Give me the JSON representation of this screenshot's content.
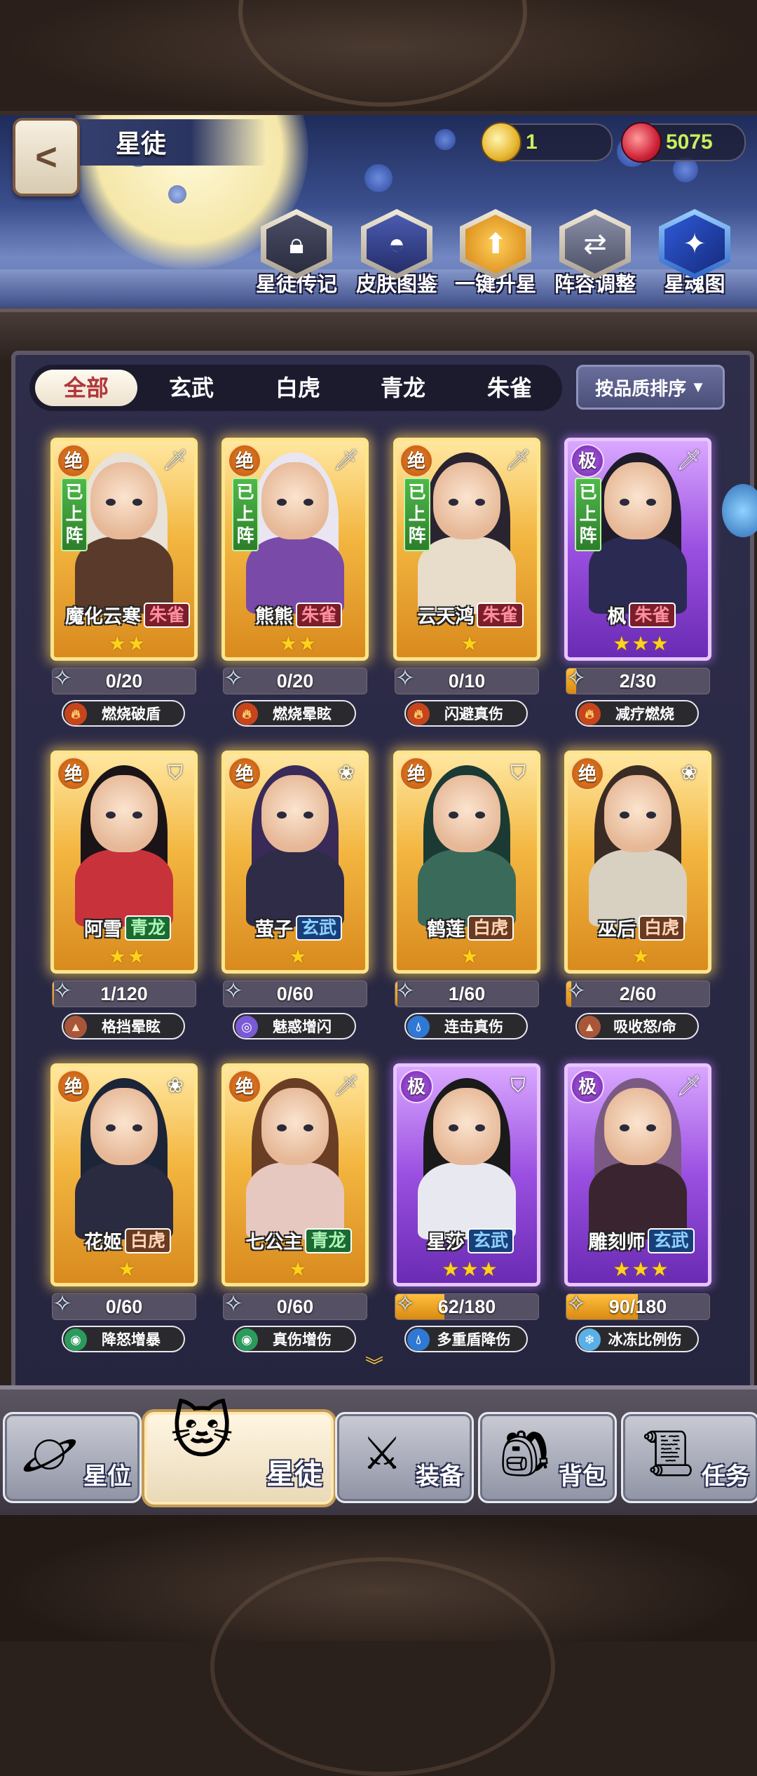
{
  "header": {
    "title": "星徒",
    "coins": "1",
    "gems": "5075"
  },
  "utility_buttons": [
    {
      "label": "星徒传记",
      "icon": "lock-icon"
    },
    {
      "label": "皮肤图鉴",
      "icon": "hood-icon"
    },
    {
      "label": "一键升星",
      "icon": "arrow-up-icon"
    },
    {
      "label": "阵容调整",
      "icon": "team-swap-icon"
    },
    {
      "label": "星魂图",
      "icon": "constellation-icon"
    }
  ],
  "tabs": [
    "全部",
    "玄武",
    "白虎",
    "青龙",
    "朱雀"
  ],
  "active_tab": "全部",
  "sort_label": "按品质排序",
  "cards": [
    {
      "rank": "绝",
      "quality": "gold",
      "role": "sword",
      "deployed": true,
      "name": "魔化云寒",
      "faction": "朱雀",
      "stars": 2,
      "progress": "0/20",
      "fill": 0,
      "skill": "燃烧破盾",
      "skill_type": "fire"
    },
    {
      "rank": "绝",
      "quality": "gold",
      "role": "sword",
      "deployed": true,
      "name": "熊熊",
      "faction": "朱雀",
      "stars": 2,
      "progress": "0/20",
      "fill": 0,
      "skill": "燃烧晕眩",
      "skill_type": "fire"
    },
    {
      "rank": "绝",
      "quality": "gold",
      "role": "sword",
      "deployed": true,
      "name": "云天鸿",
      "faction": "朱雀",
      "stars": 1,
      "progress": "0/10",
      "fill": 0,
      "skill": "闪避真伤",
      "skill_type": "fire"
    },
    {
      "rank": "极",
      "quality": "purple",
      "role": "sword",
      "deployed": true,
      "name": "枫",
      "faction": "朱雀",
      "stars": 3,
      "progress": "2/30",
      "fill": 0.067,
      "skill": "减疗燃烧",
      "skill_type": "fire"
    },
    {
      "rank": "绝",
      "quality": "gold",
      "role": "shield",
      "deployed": false,
      "name": "阿雪",
      "faction": "青龙",
      "stars": 2,
      "progress": "1/120",
      "fill": 0.008,
      "skill": "格挡晕眩",
      "skill_type": "earth"
    },
    {
      "rank": "绝",
      "quality": "gold",
      "role": "lotus",
      "deployed": false,
      "name": "萤子",
      "faction": "玄武",
      "stars": 1,
      "progress": "0/60",
      "fill": 0,
      "skill": "魅惑增闪",
      "skill_type": "spiral"
    },
    {
      "rank": "绝",
      "quality": "gold",
      "role": "shield",
      "deployed": false,
      "name": "鹤莲",
      "faction": "白虎",
      "stars": 1,
      "progress": "1/60",
      "fill": 0.017,
      "skill": "连击真伤",
      "skill_type": "water"
    },
    {
      "rank": "绝",
      "quality": "gold",
      "role": "lotus",
      "deployed": false,
      "name": "巫后",
      "faction": "白虎",
      "stars": 1,
      "progress": "2/60",
      "fill": 0.033,
      "skill": "吸收怒/命",
      "skill_type": "earth"
    },
    {
      "rank": "绝",
      "quality": "gold",
      "role": "lotus",
      "deployed": false,
      "name": "花姬",
      "faction": "白虎",
      "stars": 1,
      "progress": "0/60",
      "fill": 0,
      "skill": "降怒增暴",
      "skill_type": "wind"
    },
    {
      "rank": "绝",
      "quality": "gold",
      "role": "sword",
      "deployed": false,
      "name": "七公主",
      "faction": "青龙",
      "stars": 1,
      "progress": "0/60",
      "fill": 0,
      "skill": "真伤增伤",
      "skill_type": "wind"
    },
    {
      "rank": "极",
      "quality": "purple",
      "role": "shield",
      "deployed": false,
      "name": "星莎",
      "faction": "玄武",
      "stars": 3,
      "progress": "62/180",
      "fill": 0.344,
      "skill": "多重盾降伤",
      "skill_type": "water"
    },
    {
      "rank": "极",
      "quality": "purple",
      "role": "sword",
      "deployed": false,
      "name": "雕刻师",
      "faction": "玄武",
      "stars": 3,
      "progress": "90/180",
      "fill": 0.5,
      "skill": "冰冻比例伤",
      "skill_type": "ice"
    }
  ],
  "deployed_label": "已上阵",
  "bottom_nav": [
    {
      "label": "星位",
      "icon": "orbit-icon"
    },
    {
      "label": "星徒",
      "icon": "cat-mask-icon",
      "active": true
    },
    {
      "label": "装备",
      "icon": "sword-icon"
    },
    {
      "label": "背包",
      "icon": "chest-icon"
    },
    {
      "label": "任务",
      "icon": "scroll-icon"
    }
  ]
}
